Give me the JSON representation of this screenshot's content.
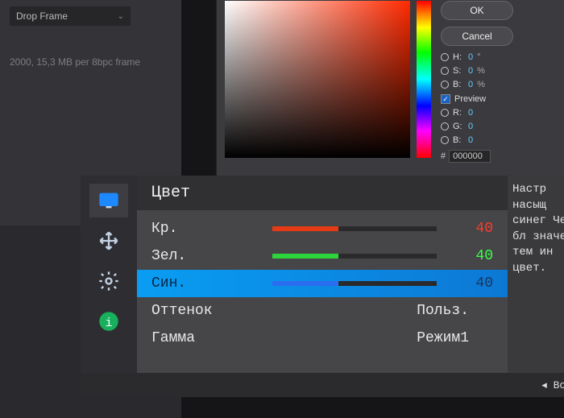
{
  "app": {
    "drop_frame_label": "Drop Frame",
    "footer_line": "2000, 15,3 MB per 8bpc frame"
  },
  "color_picker": {
    "ok": "OK",
    "cancel": "Cancel",
    "fields": {
      "h_label": "H:",
      "h_val": "0",
      "h_unit": "°",
      "s_label": "S:",
      "s_val": "0",
      "s_unit": "%",
      "b_label": "B:",
      "b_val": "0",
      "b_unit": "%",
      "r_label": "R:",
      "r_val": "0",
      "g_label": "G:",
      "g_val": "0",
      "bl_label": "B:",
      "bl_val": "0"
    },
    "hex": "000000",
    "preview_label": "Preview"
  },
  "osd": {
    "title": "Цвет",
    "rows": {
      "red": {
        "label": "Кр.",
        "value": "40"
      },
      "green": {
        "label": "Зел.",
        "value": "40"
      },
      "blue": {
        "label": "Син.",
        "value": "40"
      },
      "hue": {
        "label": "Оттенок",
        "value": "Польз."
      },
      "gamma": {
        "label": "Гамма",
        "value": "Режим1"
      }
    },
    "help": "Настр насыщ синег Чем бл значен тем ин цвет.",
    "bottom_back": "◂  Воз"
  }
}
